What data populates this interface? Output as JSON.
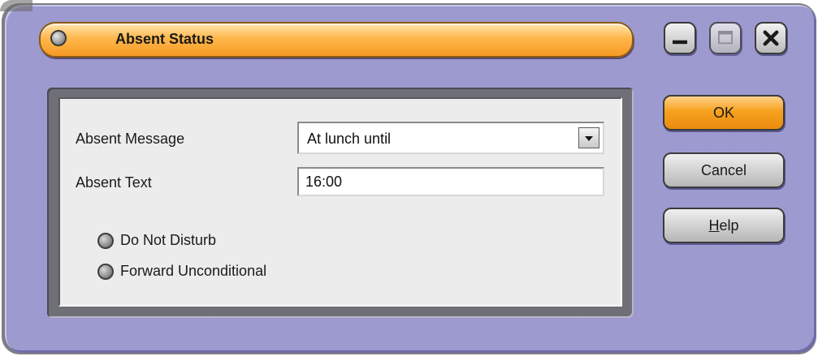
{
  "window": {
    "title": "Absent Status"
  },
  "form": {
    "absent_message_label": "Absent Message",
    "absent_message_value": "At lunch until",
    "absent_text_label": "Absent Text",
    "absent_text_value": "16:00",
    "do_not_disturb_label": "Do Not Disturb",
    "forward_unconditional_label": "Forward Unconditional"
  },
  "buttons": {
    "ok": "OK",
    "cancel": "Cancel",
    "help": "Help"
  },
  "icons": {
    "title_orb": "status-orb-icon",
    "minimize": "minimize-icon",
    "maximize": "maximize-icon",
    "close": "close-icon",
    "dropdown": "chevron-down-icon"
  },
  "colors": {
    "frame": "#9b98cf",
    "title_bar": "#f7a21f",
    "ok_button": "#f7a21f",
    "panel": "#ececec"
  }
}
